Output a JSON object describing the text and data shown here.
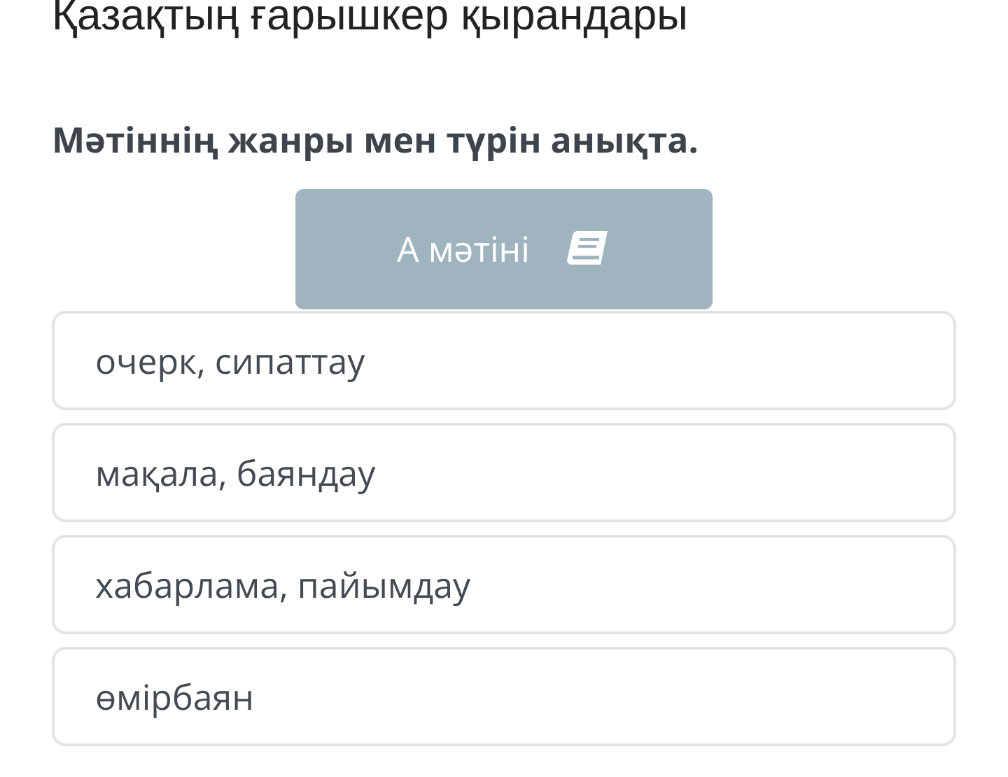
{
  "title": "Қазақтың ғарышкер қырандары",
  "question": "Мәтіннің жанры мен түрін анықта.",
  "text_button": {
    "label": "А мәтіні"
  },
  "options": [
    {
      "label": "очерк, сипаттау"
    },
    {
      "label": "мақала, баяндау"
    },
    {
      "label": "хабарлама, пайымдау"
    },
    {
      "label": "өмірбаян"
    }
  ]
}
